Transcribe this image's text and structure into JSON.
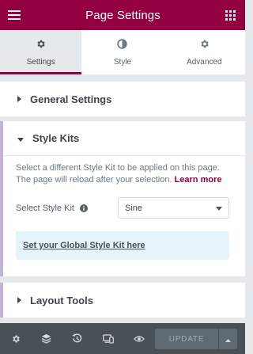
{
  "header": {
    "title": "Page Settings",
    "menu_icon": "hamburger-icon",
    "grid_icon": "grid-icon"
  },
  "tabs": [
    {
      "label": "Settings",
      "icon": "gear-icon",
      "active": true
    },
    {
      "label": "Style",
      "icon": "contrast-icon",
      "active": false
    },
    {
      "label": "Advanced",
      "icon": "gear-icon",
      "active": false
    }
  ],
  "sections": {
    "general": {
      "title": "General Settings"
    },
    "style_kits": {
      "title": "Style Kits",
      "description": "Select a different Style Kit to be applied on this page. The page will reload after your selection.",
      "learn_more": "Learn more",
      "select_label": "Select Style Kit",
      "select_value": "Sine",
      "global_link": "Set your Global Style Kit here"
    },
    "layout_tools": {
      "title": "Layout Tools"
    }
  },
  "footer": {
    "update_label": "UPDATE"
  },
  "colors": {
    "brand": "#93003f",
    "accent_bar": "#c3b3d9",
    "notice_bg": "#e5f3fb",
    "footer_bg": "#495157"
  }
}
